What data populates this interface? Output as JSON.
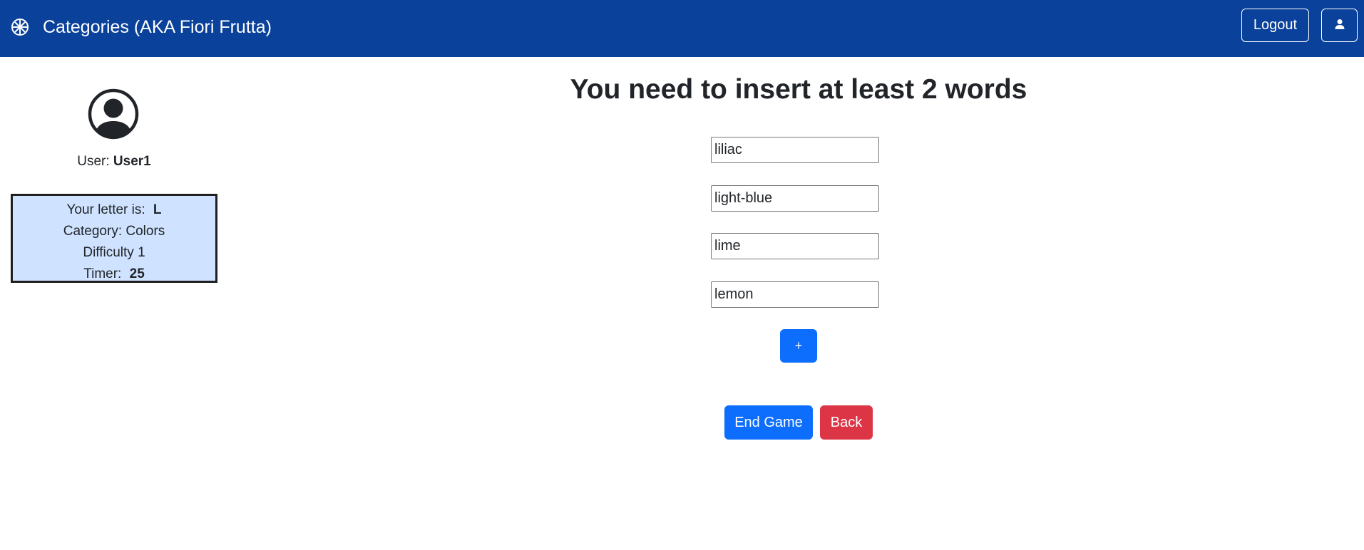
{
  "navbar": {
    "brand_icon": "flower-icon",
    "title": "Categories (AKA Fiori Frutta)",
    "logout_label": "Logout",
    "user_icon": "person-icon",
    "background_color": "#0a419a"
  },
  "sidebar": {
    "avatar_icon": "person-circle-icon",
    "user_prefix": "User:",
    "username": "User1",
    "info": {
      "letter_label": "Your letter is:",
      "letter": "L",
      "category_text": "Category: Colors",
      "difficulty_text": "Difficulty 1",
      "timer_label": "Timer:",
      "timer_value": "25"
    }
  },
  "main": {
    "title": "You need to insert at least 2 words",
    "words": [
      "liliac",
      "light-blue",
      "lime",
      "lemon"
    ],
    "add_label": "+",
    "end_game_label": "End Game",
    "back_label": "Back"
  },
  "colors": {
    "primary": "#0d6efd",
    "danger": "#dc3545",
    "info_box_bg": "#cfe2ff"
  }
}
